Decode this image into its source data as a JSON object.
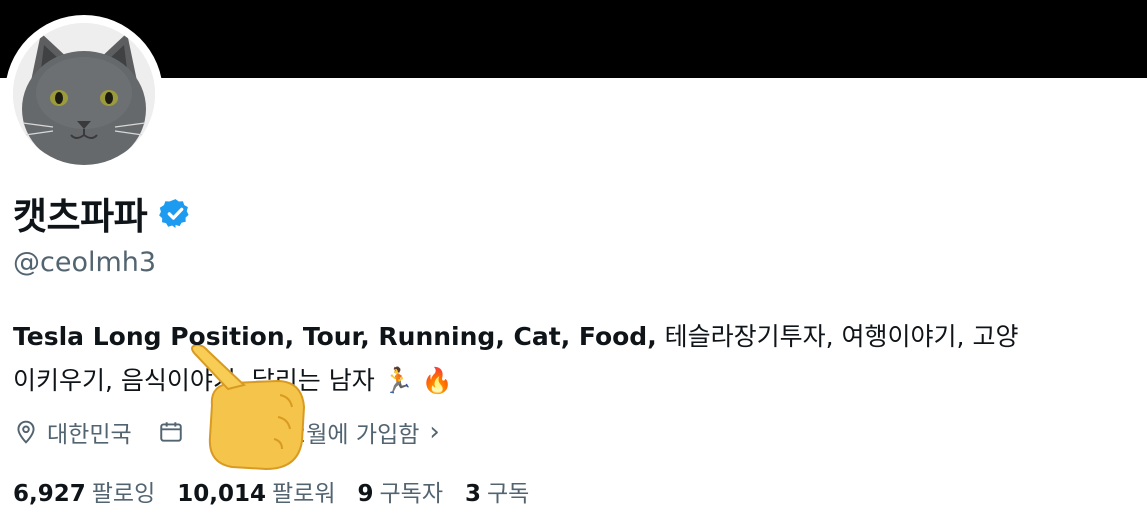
{
  "profile": {
    "display_name": "캣츠파파",
    "handle": "@ceolmh3",
    "bio_line1_bold": "Tesla Long Position, Tour, Running, Cat, Food,",
    "bio_line1_rest": " 테슬라장기투자, 여행이야기, 고양",
    "bio_line2": "이키우기, 음식이야기, 달리는 남자",
    "bio_emoji": "🏃 🔥",
    "location": "대한민국",
    "joined": "2월에 가입함",
    "joined_chevron": "›"
  },
  "stats": {
    "following_count": "6,927",
    "following_label": "팔로잉",
    "followers_count": "10,014",
    "followers_label": "팔로워",
    "subscribers_count": "9",
    "subscribers_label": "구독자",
    "subscriptions_count": "3",
    "subscriptions_label": "구독"
  },
  "colors": {
    "verified": "#1d9bf0",
    "secondary_text": "#536471",
    "primary_text": "#0f1419",
    "banner": "#000000"
  },
  "icons": {
    "verified": "verified-badge-icon",
    "location": "location-pin-icon",
    "calendar": "calendar-icon",
    "overlay": "thumbs-pointing-hand-emoji"
  }
}
